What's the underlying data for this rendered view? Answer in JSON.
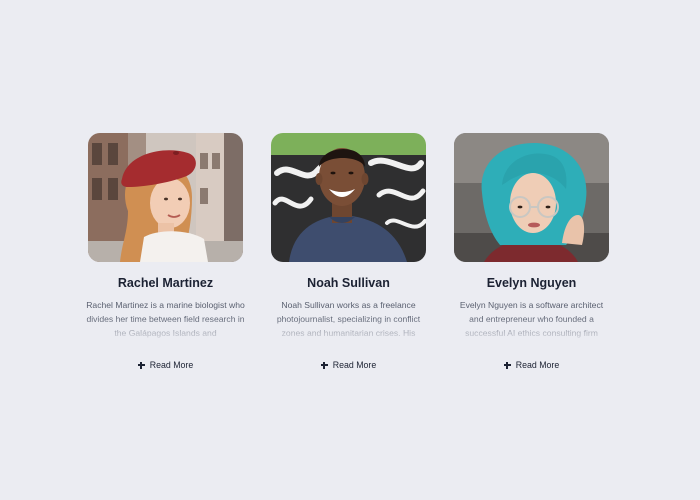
{
  "cards": [
    {
      "name": "Rachel Martinez",
      "bio": "Rachel Martinez is a marine biologist who divides her time between field research in the Galápagos Islands and",
      "read_more_label": "Read More",
      "photo_alt": "rachel-photo"
    },
    {
      "name": "Noah Sullivan",
      "bio": "Noah Sullivan works as a freelance photojournalist, specializing in conflict zones and humanitarian crises. His",
      "read_more_label": "Read More",
      "photo_alt": "noah-photo"
    },
    {
      "name": "Evelyn Nguyen",
      "bio": "Evelyn Nguyen is a software architect and entrepreneur who founded a successful AI ethics consulting firm",
      "read_more_label": "Read More",
      "photo_alt": "evelyn-photo"
    }
  ],
  "colors": {
    "background": "#ebecf2",
    "name_text": "#1c2233",
    "bio_text": "#5a6070"
  },
  "icons": {
    "read_more": "plus-icon"
  }
}
